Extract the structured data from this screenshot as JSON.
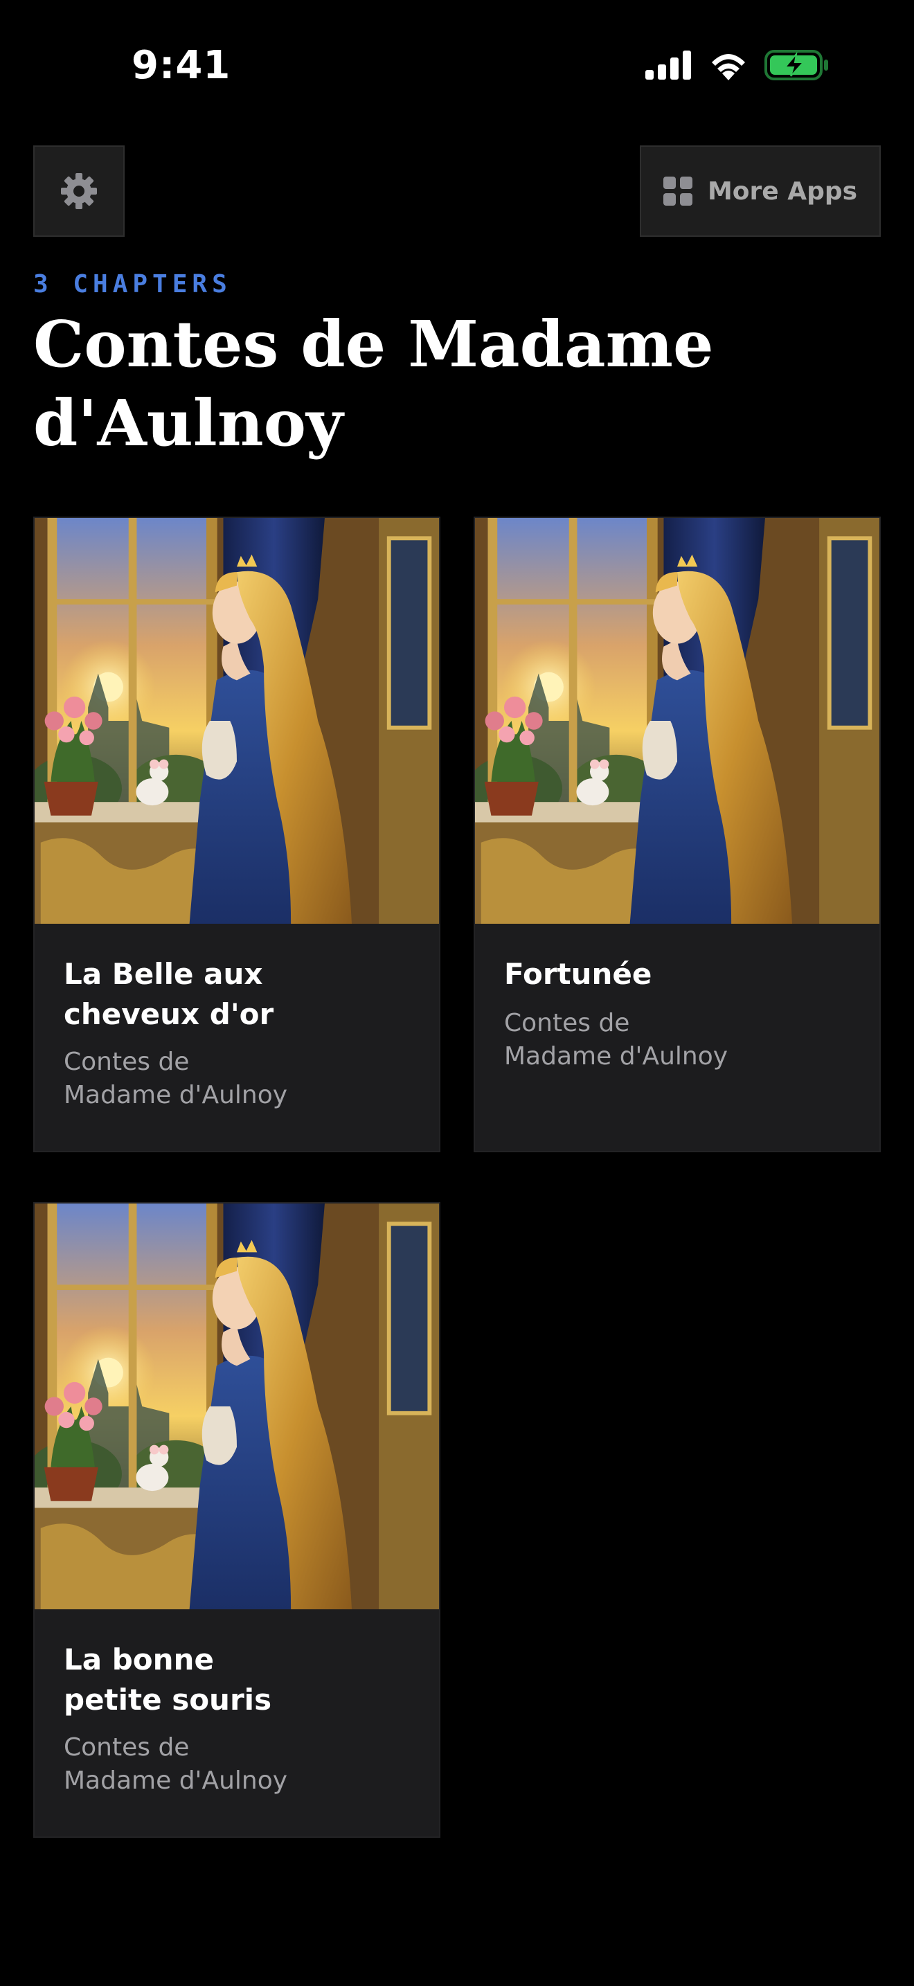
{
  "status_bar": {
    "time": "9:41",
    "icons": [
      "signal-icon",
      "wifi-icon",
      "battery-charging-icon"
    ],
    "battery_color": "#34c759"
  },
  "toolbar": {
    "settings_icon": "gear-icon",
    "more_apps_label": "More Apps",
    "more_apps_icon": "grid-icon"
  },
  "header": {
    "chapter_count": "3 CHAPTERS",
    "title": "Contes de Madame d'Aulnoy"
  },
  "colors": {
    "accent": "#4a7ee0",
    "background": "#000000",
    "card_background": "#1c1c1e",
    "muted_text": "#a2a2a6"
  },
  "chapters": [
    {
      "title": "La Belle aux\ncheveux d'or",
      "subtitle": "Contes de\nMadame d'Aulnoy"
    },
    {
      "title": "Fortunée",
      "subtitle": "Contes de\nMadame d'Aulnoy"
    },
    {
      "title": "La bonne\npetite souris",
      "subtitle": "Contes de\nMadame d'Aulnoy"
    }
  ]
}
